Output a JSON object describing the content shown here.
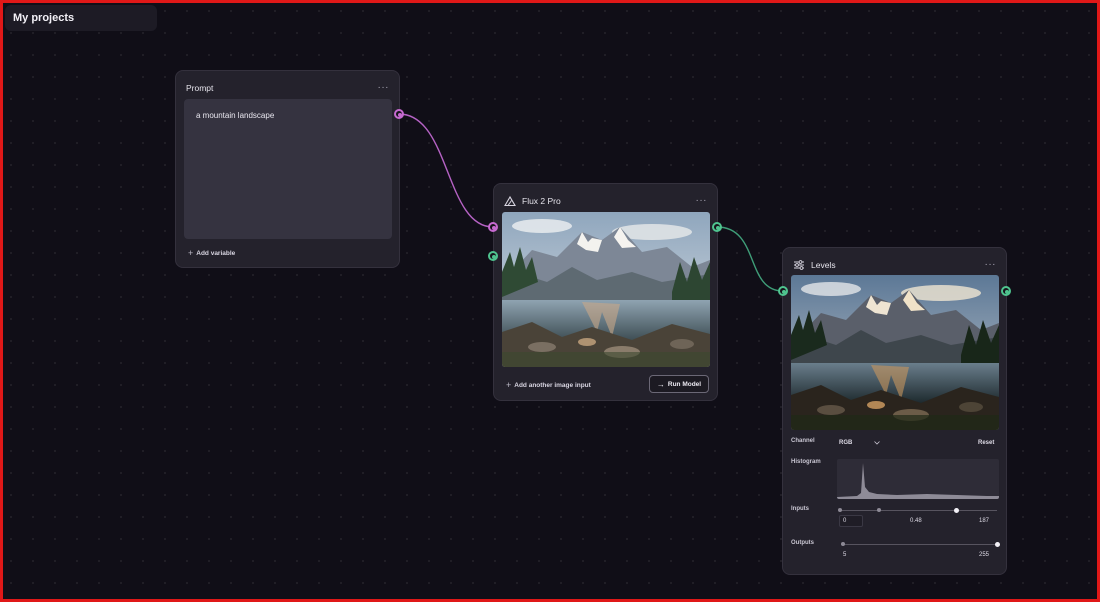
{
  "header": {
    "project_label": "My projects"
  },
  "prompt_node": {
    "title": "Prompt",
    "menu": "···",
    "text": "a mountain landscape",
    "add_variable": "Add variable"
  },
  "flux_node": {
    "title": "Flux 2 Pro",
    "menu": "···",
    "add_image_input": "Add another image input",
    "run_button": "Run Model",
    "icon": "flux-logo-icon"
  },
  "levels_node": {
    "title": "Levels",
    "menu": "···",
    "icon": "sliders-icon",
    "channel_label": "Channel",
    "channel_value": "RGB",
    "reset_label": "Reset",
    "histogram_label": "Histogram",
    "inputs_label": "Inputs",
    "inputs_values": [
      "0",
      "0.48",
      "187"
    ],
    "inputs_levels": {
      "black": 0,
      "gamma": 0.48,
      "white": 187
    },
    "outputs_label": "Outputs",
    "outputs_values": [
      "5",
      "255"
    ],
    "outputs_levels": {
      "black": 5,
      "white": 255
    }
  },
  "colors": {
    "canvas": "#100e17",
    "node": "#24222c",
    "text_port": "#c66ad0",
    "image_port": "#4fc48f",
    "frame": "#e01818"
  }
}
